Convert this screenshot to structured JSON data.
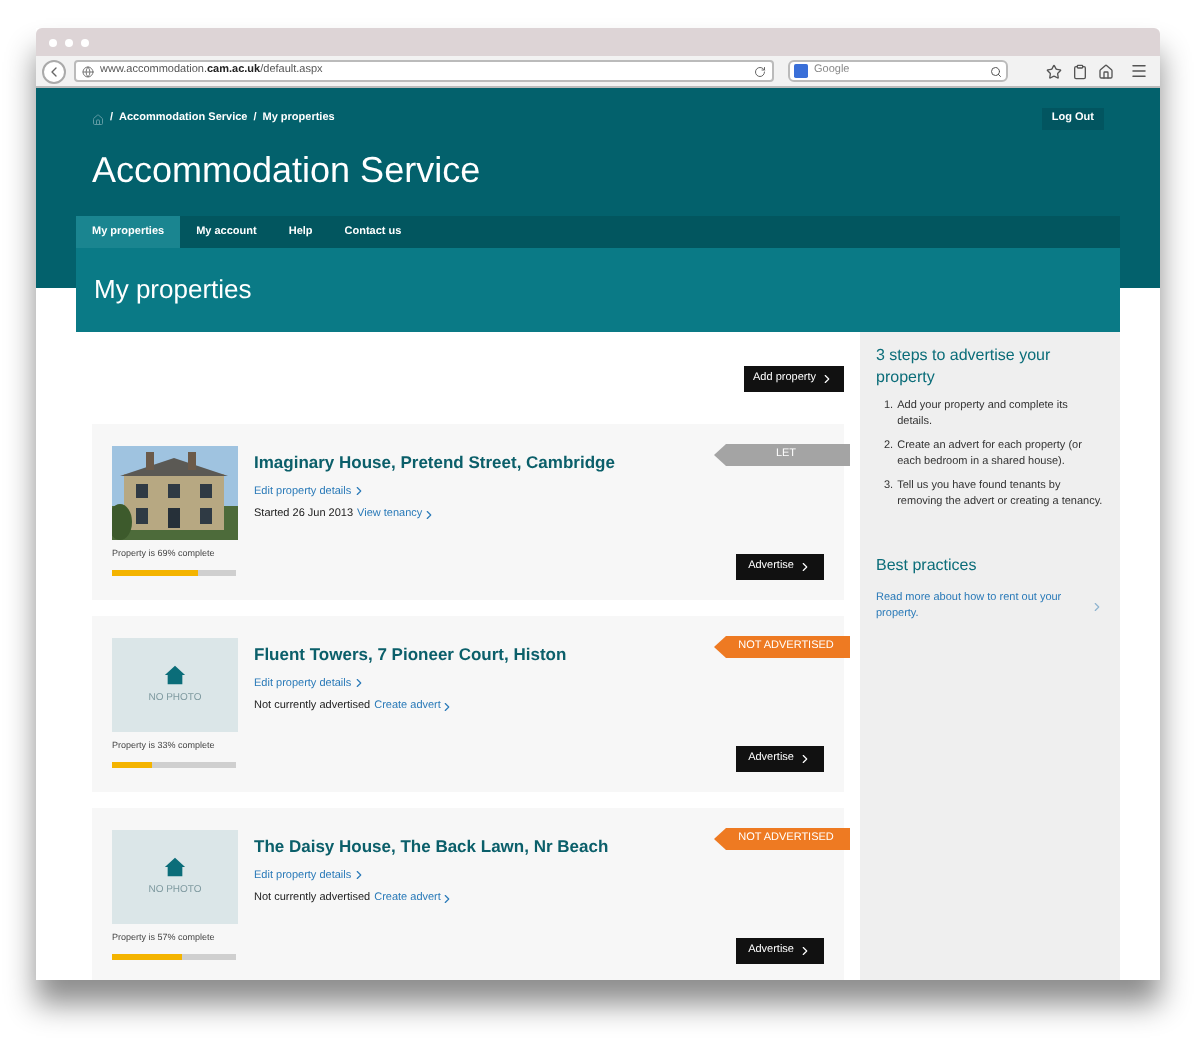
{
  "browser": {
    "url": [
      "www.accommodation.",
      "cam.ac.uk",
      "/default.aspx"
    ],
    "search_placeholder": "Google"
  },
  "breadcrumb": [
    {
      "separator": "/",
      "label": "Accommodation Service"
    },
    {
      "separator": "/",
      "label": "My properties"
    }
  ],
  "logout": "Log Out",
  "site_title": "Accommodation Service",
  "nav": [
    {
      "label": "My properties",
      "selected": true
    },
    {
      "label": "My account",
      "selected": false
    },
    {
      "label": "Help",
      "selected": false
    },
    {
      "label": "Contact us",
      "selected": false
    }
  ],
  "page_heading": "My properties",
  "add_button": "Add property",
  "properties": [
    {
      "kind": "picture",
      "title": "Imaginary House, Pretend Street, Cambridge",
      "edit_link": "Edit property details",
      "status_text": "Started 26 Jun 2013",
      "status_link": "View tenancy",
      "tag": {
        "label": "LET",
        "color": "#a4a4a4"
      },
      "completion": "Property is 69% complete",
      "level": 0.69,
      "button": "Advertise"
    },
    {
      "kind": "no_photo",
      "photo_label": "NO PHOTO",
      "title": "Fluent Towers, 7 Pioneer Court, Histon",
      "edit_link": "Edit property details",
      "status_text": "Not currently advertised",
      "status_link": "Create advert",
      "tag": {
        "label": "NOT ADVERTISED",
        "color": "#ee7a22"
      },
      "completion": "Property is 33% complete",
      "level": 0.33,
      "button": "Advertise"
    },
    {
      "kind": "no_photo",
      "photo_label": "NO PHOTO",
      "title": "The Daisy House, The Back Lawn, Nr Beach",
      "edit_link": "Edit property details",
      "status_text": "Not currently advertised",
      "status_link": "Create advert",
      "tag": {
        "label": "NOT ADVERTISED",
        "color": "#ee7a22"
      },
      "completion": "Property is 57% complete",
      "level": 0.57,
      "button": "Advertise"
    }
  ],
  "sidebar": {
    "steps_title": "3 steps to advertise your property",
    "steps": [
      {
        "number": "1.",
        "text": "Add your property and complete its details."
      },
      {
        "number": "2.",
        "text": "Create an advert for each property (or each bedroom in a shared house)."
      },
      {
        "number": "3.",
        "text": "Tell us you have found tenants by removing the advert or creating a tenancy."
      }
    ],
    "practices_title": "Best practices",
    "practices_link": "Read more about how to rent out your property."
  }
}
